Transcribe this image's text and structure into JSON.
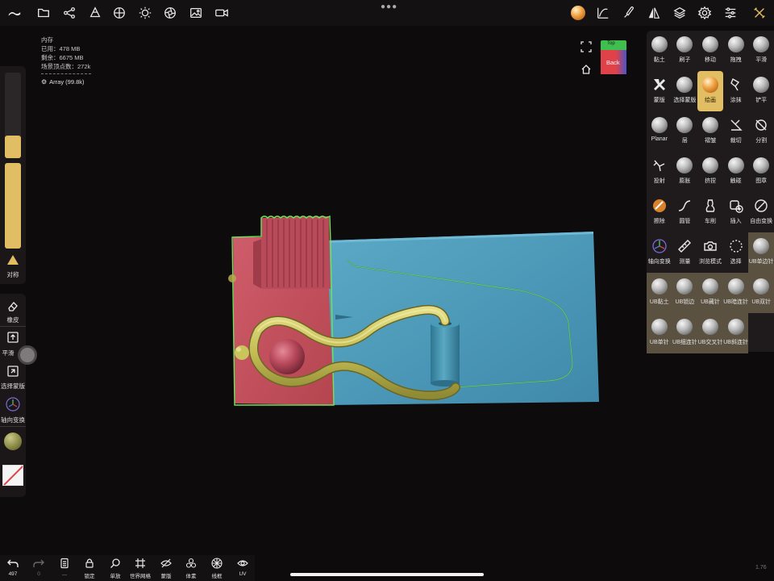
{
  "stats": {
    "title": "内存",
    "used": "已用：478 MB",
    "remaining": "剩余：6675 MB",
    "vertices": "场景顶点数：272k",
    "object": "Array (99.8k)"
  },
  "left_panel": {
    "symmetry_label": "对称",
    "eraser_label": "橡皮",
    "smooth_label": "平滑",
    "select_mask_label": "选择蒙版",
    "gizmo_label": "轴向变换"
  },
  "view_cube": {
    "top_label": "Top",
    "front_label": "Back"
  },
  "tools": {
    "items": [
      {
        "label": "黏土",
        "icon": "clay-sphere"
      },
      {
        "label": "刷子",
        "icon": "brush-sphere"
      },
      {
        "label": "移动",
        "icon": "move-sphere"
      },
      {
        "label": "拖拽",
        "icon": "drag-sphere"
      },
      {
        "label": "平滑",
        "icon": "smooth-sphere"
      },
      {
        "label": "蒙版",
        "icon": "mask-icon"
      },
      {
        "label": "选择蒙版",
        "icon": "select-mask-sphere"
      },
      {
        "label": "绘画",
        "icon": "paint-sphere",
        "active": true
      },
      {
        "label": "涂抹",
        "icon": "smudge-icon"
      },
      {
        "label": "铲平",
        "icon": "flatten-sphere"
      },
      {
        "label": "Planar",
        "icon": "planar-sphere"
      },
      {
        "label": "层",
        "icon": "layer-sphere"
      },
      {
        "label": "褶皱",
        "icon": "crease-sphere"
      },
      {
        "label": "裁切",
        "icon": "trim-icon"
      },
      {
        "label": "分割",
        "icon": "split-icon"
      },
      {
        "label": "投射",
        "icon": "project-icon"
      },
      {
        "label": "膨胀",
        "icon": "inflate-sphere"
      },
      {
        "label": "挤捏",
        "icon": "pinch-sphere"
      },
      {
        "label": "触碰",
        "icon": "tube-sphere"
      },
      {
        "label": "图章",
        "icon": "stamp-sphere"
      },
      {
        "label": "擦除",
        "icon": "erase-icon"
      },
      {
        "label": "圆管",
        "icon": "tube-icon"
      },
      {
        "label": "车削",
        "icon": "lathe-icon"
      },
      {
        "label": "插入",
        "icon": "insert-icon"
      },
      {
        "label": "自由变换",
        "icon": "free-transform-icon"
      },
      {
        "label": "轴向变换",
        "icon": "gizmo-icon"
      },
      {
        "label": "测量",
        "icon": "ruler-icon"
      },
      {
        "label": "浏览模式",
        "icon": "camera-icon"
      },
      {
        "label": "选择",
        "icon": "select-icon"
      },
      {
        "label": "UB单边针",
        "icon": "ub-sphere"
      },
      {
        "label": "UB黏土",
        "icon": "ub-sphere"
      },
      {
        "label": "UB锁边",
        "icon": "ub-sphere"
      },
      {
        "label": "UB藏针",
        "icon": "ub-sphere"
      },
      {
        "label": "UB暗连针",
        "icon": "ub-sphere"
      },
      {
        "label": "UB双针",
        "icon": "ub-sphere"
      },
      {
        "label": "UB单针",
        "icon": "ub-sphere"
      },
      {
        "label": "UB细连针",
        "icon": "ub-sphere"
      },
      {
        "label": "UB交叉针",
        "icon": "ub-sphere"
      },
      {
        "label": "UB斜连针",
        "icon": "ub-sphere"
      }
    ]
  },
  "bottom": {
    "undo_count": "497",
    "redo_count": "0",
    "items": [
      {
        "label": "…",
        "icon": "document-icon"
      },
      {
        "label": "锁定",
        "icon": "lock-icon"
      },
      {
        "label": "单放",
        "icon": "search-icon"
      },
      {
        "label": "世界网格",
        "icon": "grid-icon"
      },
      {
        "label": "蒙版",
        "icon": "mask-eye-icon"
      },
      {
        "label": "体素",
        "icon": "voxel-icon"
      },
      {
        "label": "线框",
        "icon": "wireframe-icon"
      },
      {
        "label": "UV",
        "icon": "uv-icon"
      }
    ]
  },
  "version": "1.76",
  "colors": {
    "accent": "#e1bd64",
    "panel": "#1f1b1c",
    "mesh_red": "#c4505f",
    "mesh_blue": "#4a93b4",
    "mesh_yellow": "#c9c45c",
    "selection": "#6fe35a"
  }
}
